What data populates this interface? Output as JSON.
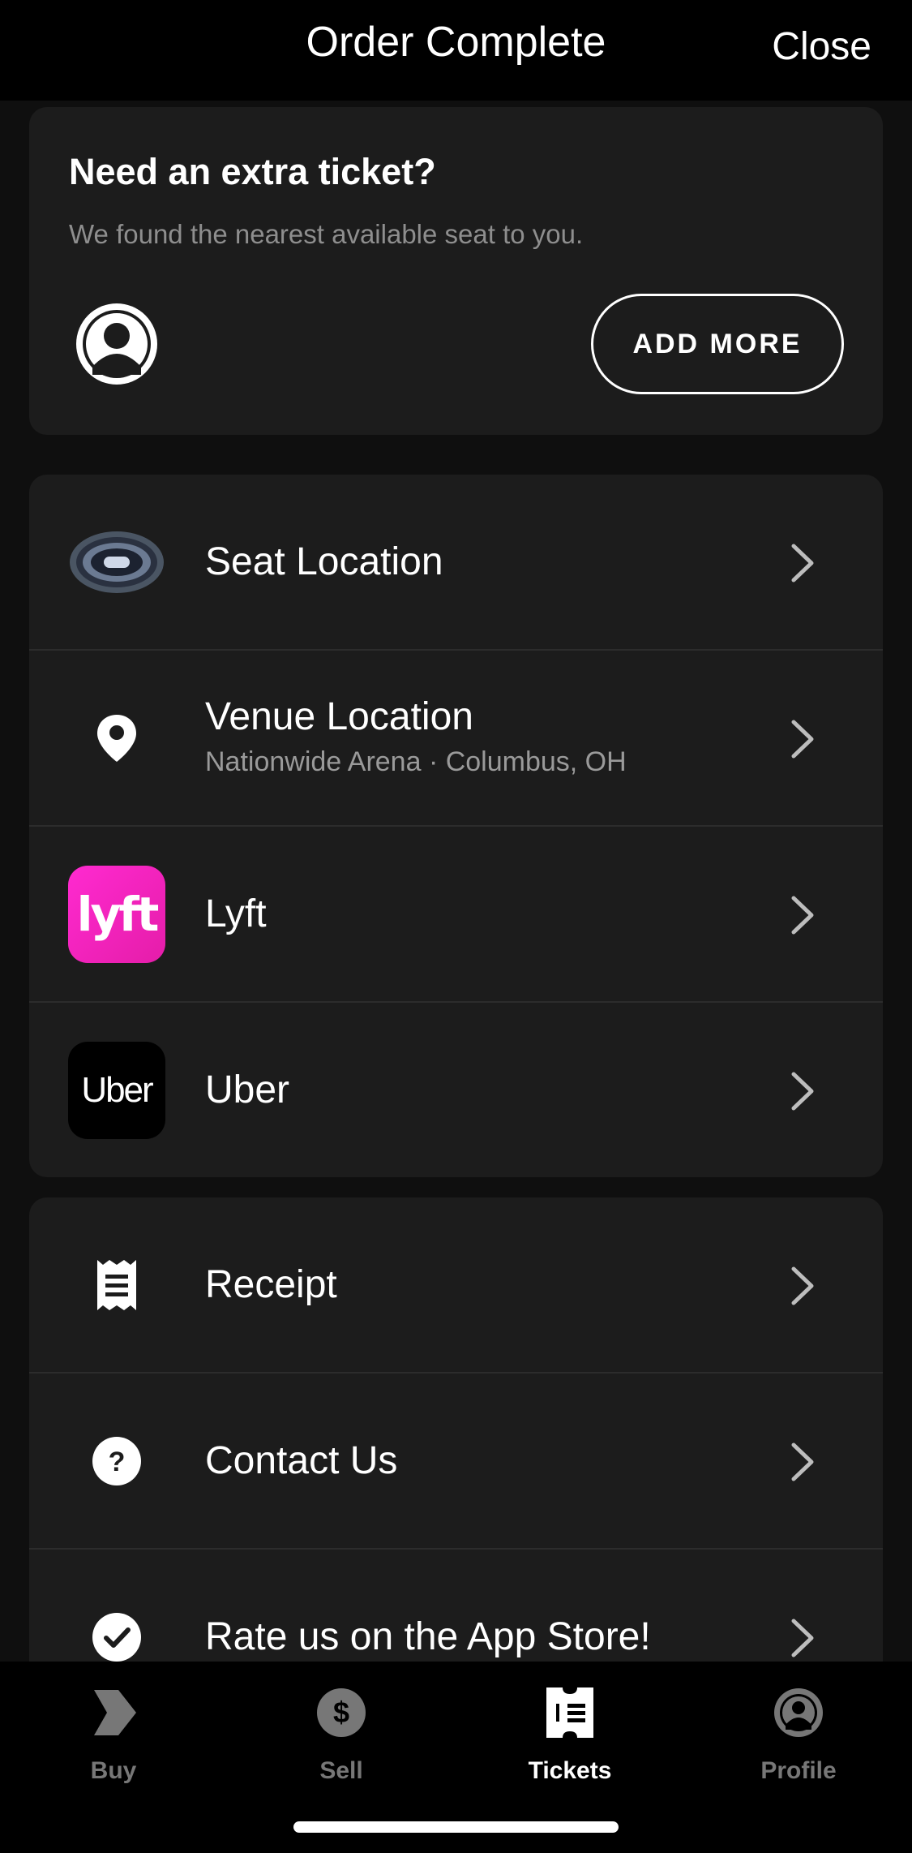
{
  "header": {
    "title": "Order Complete",
    "close_label": "Close"
  },
  "promo": {
    "title": "Need an extra ticket?",
    "subtitle": "We found the nearest available seat to you.",
    "button_label": "ADD MORE"
  },
  "links": [
    {
      "label": "Seat Location",
      "icon": "arena-map-icon"
    },
    {
      "label": "Venue Location",
      "subtitle": "Nationwide Arena · Columbus, OH",
      "icon": "map-pin-icon"
    },
    {
      "label": "Lyft",
      "icon": "lyft-logo",
      "logo_text": "lyft"
    },
    {
      "label": "Uber",
      "icon": "uber-logo",
      "logo_text": "Uber"
    }
  ],
  "support": [
    {
      "label": "Receipt",
      "icon": "receipt-icon"
    },
    {
      "label": "Contact Us",
      "icon": "question-icon"
    },
    {
      "label": "Rate us on the App Store!",
      "icon": "checkmark-icon"
    }
  ],
  "tabs": [
    {
      "label": "Buy",
      "icon": "buy-icon",
      "active": false
    },
    {
      "label": "Sell",
      "icon": "dollar-icon",
      "active": false
    },
    {
      "label": "Tickets",
      "icon": "ticket-icon",
      "active": true
    },
    {
      "label": "Profile",
      "icon": "profile-icon",
      "active": false
    }
  ],
  "colors": {
    "background": "#0f0f0f",
    "card": "#1c1c1c",
    "lyft": "#ff00bf",
    "inactive_tab": "#777777"
  }
}
